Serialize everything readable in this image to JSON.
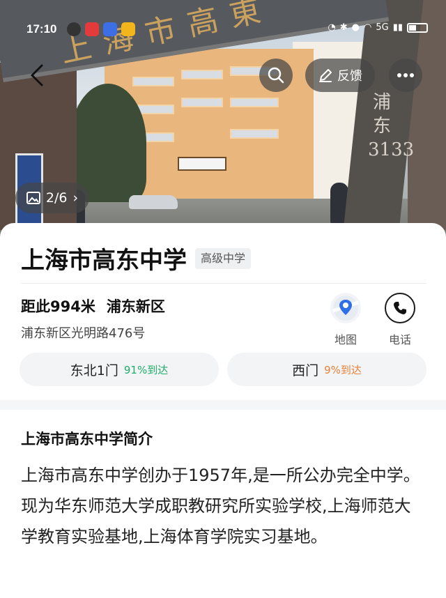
{
  "status_bar": {
    "time": "17:10",
    "network": "5G"
  },
  "photo": {
    "gate_sign": "上海市高東",
    "pillar_text": "浦东3133",
    "counter": "2/6"
  },
  "header_actions": {
    "feedback_label": "反馈"
  },
  "poi": {
    "name": "上海市高东中学",
    "level_tag": "高级中学",
    "distance": "距此994米",
    "district": "浦东新区",
    "address": "浦东新区光明路476号"
  },
  "actions": {
    "map_label": "地图",
    "phone_label": "电话"
  },
  "gates": [
    {
      "name": "东北1门",
      "arrival": "91%到达",
      "color": "#1fae6b"
    },
    {
      "name": "西门",
      "arrival": "9%到达",
      "color": "#e8823a"
    }
  ],
  "intro": {
    "title": "上海市高东中学简介",
    "body": "上海市高东中学创办于1957年,是一所公办完全中学。现为华东师范大学成职教研究所实验学校,上海师范大学教育实验基地,上海体育学院实习基地。"
  }
}
